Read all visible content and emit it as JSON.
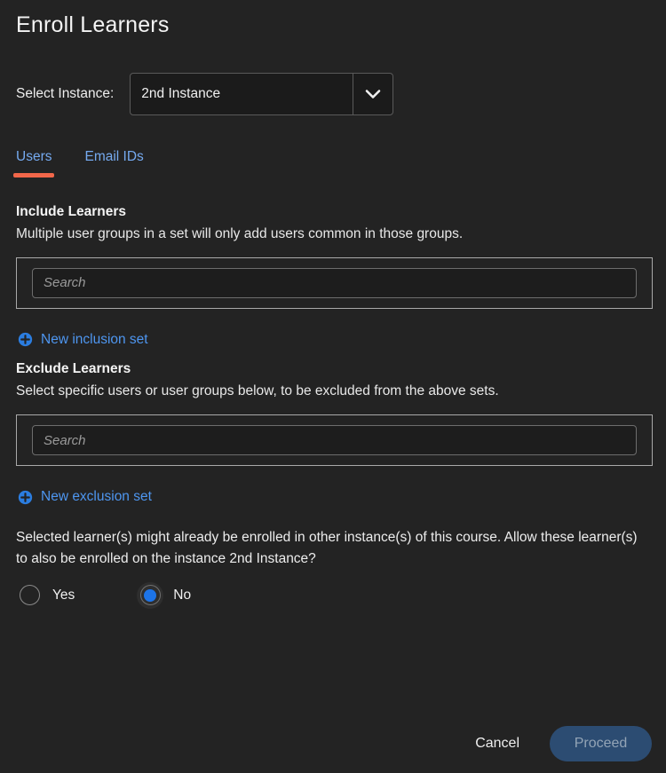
{
  "dialog": {
    "title": "Enroll Learners"
  },
  "instance": {
    "label": "Select Instance:",
    "selected": "2nd Instance",
    "chevron_icon": "chevron-down-icon"
  },
  "tabs": [
    {
      "label": "Users",
      "active": true
    },
    {
      "label": "Email IDs",
      "active": false
    }
  ],
  "include": {
    "heading": "Include Learners",
    "description": "Multiple user groups in a set will only add users common in those groups.",
    "search_placeholder": "Search",
    "search_value": "",
    "new_set_label": "New inclusion set",
    "new_set_icon": "plus-circle-icon"
  },
  "exclude": {
    "heading": "Exclude Learners",
    "description": "Select specific users or user groups below, to be excluded from the above sets.",
    "search_placeholder": "Search",
    "search_value": "",
    "new_set_label": "New exclusion set",
    "new_set_icon": "plus-circle-icon"
  },
  "note": {
    "text": "Selected learner(s) might already be enrolled in other instance(s) of this course. Allow these learner(s) to also be enrolled on the instance 2nd Instance?"
  },
  "radio": {
    "yes_label": "Yes",
    "no_label": "No",
    "selected": "No"
  },
  "footer": {
    "cancel_label": "Cancel",
    "proceed_label": "Proceed",
    "proceed_disabled": true
  },
  "colors": {
    "background": "#232323",
    "accent_blue": "#4e96f0",
    "tab_text": "#75aaf0",
    "tab_underline": "#f2674a",
    "radio_selected": "#1d74e8",
    "proceed_bg": "#2c4c72",
    "proceed_text": "#93a4b6"
  }
}
